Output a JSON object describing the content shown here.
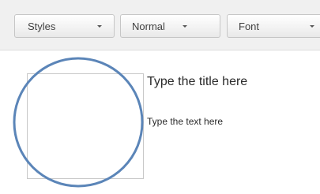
{
  "toolbar": {
    "styles_combo": {
      "value": "Styles"
    },
    "format_combo": {
      "value": "Normal"
    },
    "font_combo": {
      "value": "Font"
    }
  },
  "editor": {
    "title_placeholder": "Type the title here",
    "text_placeholder": "Type the text here"
  },
  "colors": {
    "highlight_circle": "#5b85b8",
    "toolbar_bg": "#f0f0f0"
  }
}
